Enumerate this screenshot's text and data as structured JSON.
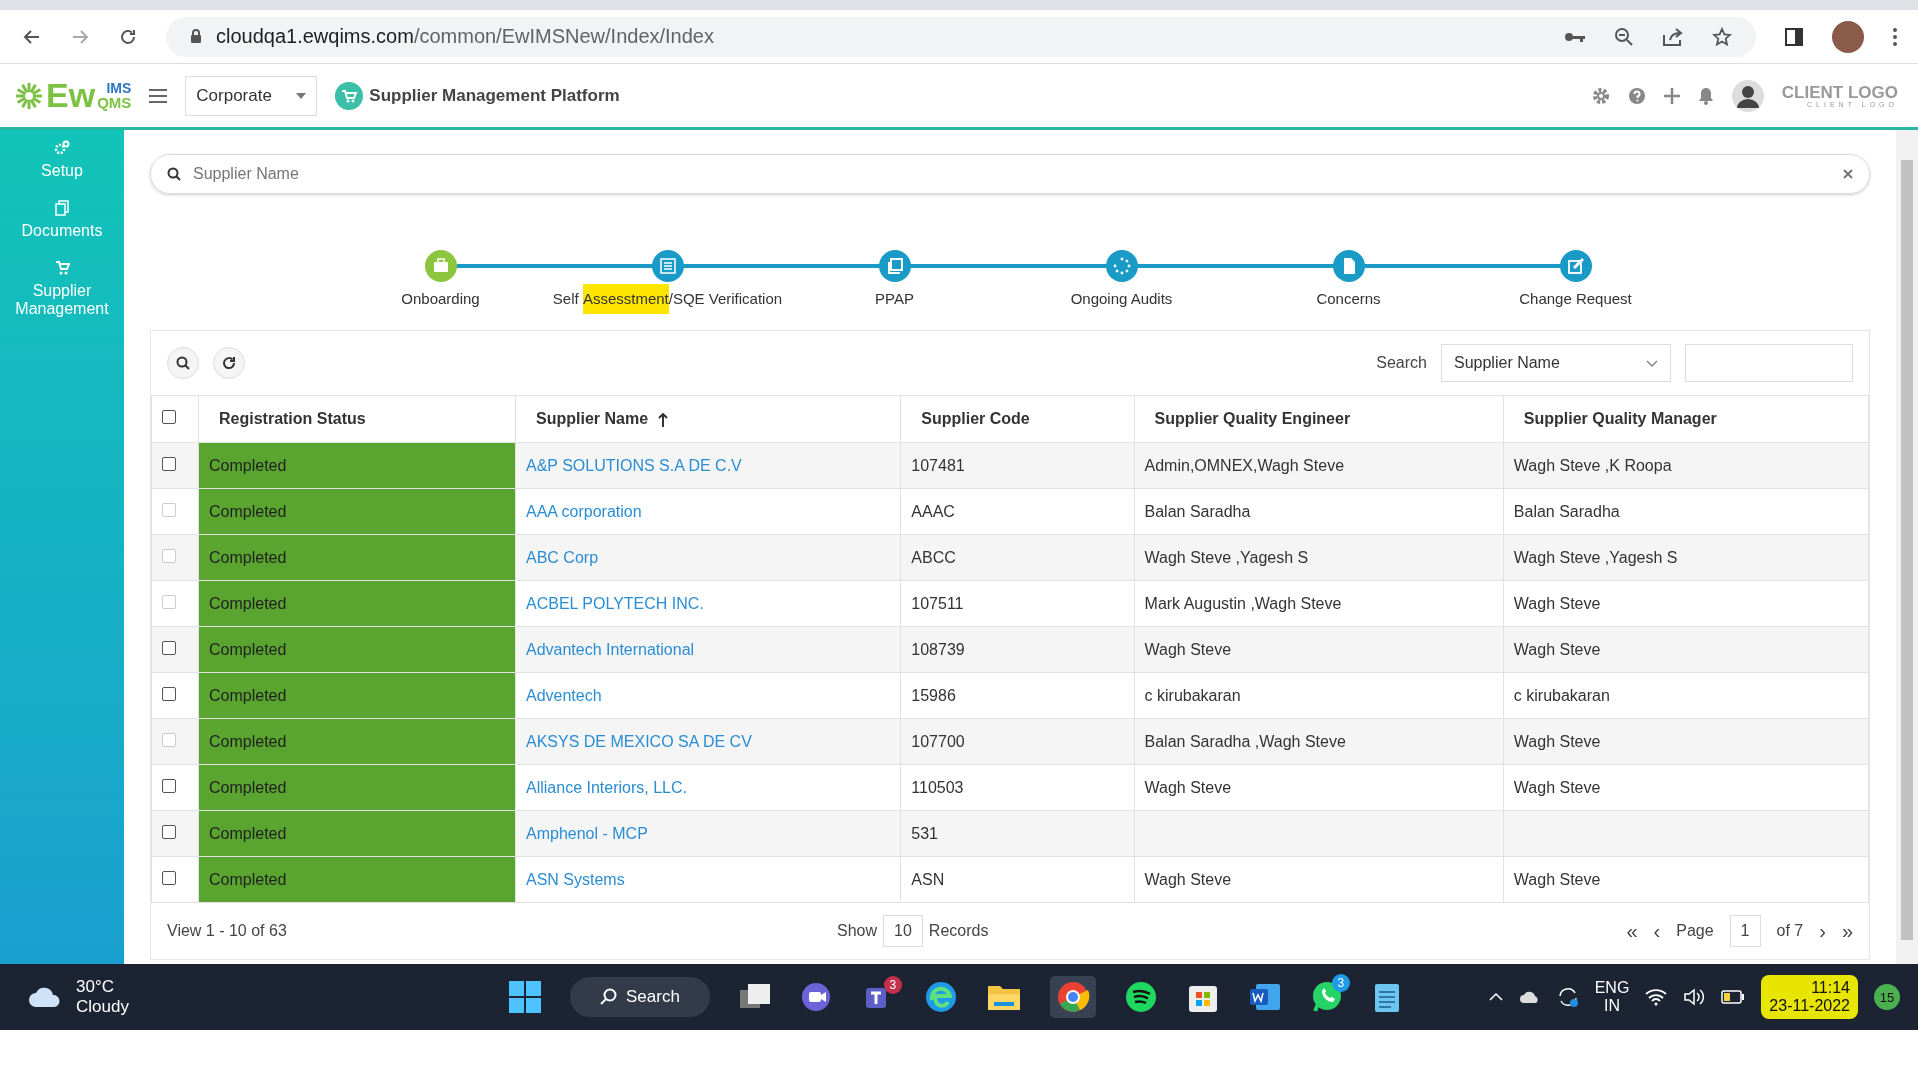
{
  "browser": {
    "url_host": "cloudqa1.ewqims.com",
    "url_path": "/common/EwIMSNew/Index/Index"
  },
  "header": {
    "logo_main": "Ew",
    "logo_top": "IMS",
    "logo_bottom": "QMS",
    "unit_select": "Corporate",
    "platform_title": "Supplier Management Platform",
    "client_logo": "CLIENT LOGO",
    "client_logo_sub": "CLIENT LOGO"
  },
  "sidebar": {
    "items": [
      {
        "label": "Setup"
      },
      {
        "label": "Documents"
      },
      {
        "label": "Supplier Management"
      }
    ]
  },
  "search": {
    "placeholder": "Supplier Name"
  },
  "steps": [
    {
      "label": [
        {
          "text": "Onboarding",
          "highlight": false
        }
      ],
      "color": "#8cc63f"
    },
    {
      "label": [
        {
          "text": "Self ",
          "highlight": false
        },
        {
          "text": "Assesstment",
          "highlight": true
        },
        {
          "text": "/SQE Verification",
          "highlight": false
        }
      ],
      "color": "#1a9bc7"
    },
    {
      "label": [
        {
          "text": "PPAP",
          "highlight": false
        }
      ],
      "color": "#1a9bc7"
    },
    {
      "label": [
        {
          "text": "Ongoing Audits",
          "highlight": false
        }
      ],
      "color": "#1a9bc7"
    },
    {
      "label": [
        {
          "text": "Concerns",
          "highlight": false
        }
      ],
      "color": "#1a9bc7"
    },
    {
      "label": [
        {
          "text": "Change Request",
          "highlight": false
        }
      ],
      "color": "#1a9bc7"
    }
  ],
  "toolbar": {
    "search_label": "Search",
    "search_by": "Supplier Name"
  },
  "table": {
    "select_all_checked": false,
    "columns": [
      {
        "label": "Registration Status",
        "sorted": false
      },
      {
        "label": "Supplier Name",
        "sorted": true
      },
      {
        "label": "Supplier Code",
        "sorted": false
      },
      {
        "label": "Supplier Quality Engineer",
        "sorted": false
      },
      {
        "label": "Supplier Quality Manager",
        "sorted": false
      }
    ],
    "rows": [
      {
        "checked": false,
        "disabled": false,
        "status": "Completed",
        "name": "A&P SOLUTIONS S.A DE C.V",
        "code": "107481",
        "engineer": "Admin,OMNEX,Wagh Steve",
        "manager": "Wagh Steve ,K Roopa"
      },
      {
        "checked": false,
        "disabled": true,
        "status": "Completed",
        "name": "AAA corporation",
        "code": "AAAC",
        "engineer": "Balan Saradha",
        "manager": "Balan Saradha"
      },
      {
        "checked": false,
        "disabled": true,
        "status": "Completed",
        "name": "ABC Corp",
        "code": "ABCC",
        "engineer": "Wagh Steve ,Yagesh S",
        "manager": "Wagh Steve ,Yagesh S"
      },
      {
        "checked": false,
        "disabled": true,
        "status": "Completed",
        "name": "ACBEL POLYTECH INC.",
        "code": "107511",
        "engineer": "Mark Augustin ,Wagh Steve",
        "manager": "Wagh Steve"
      },
      {
        "checked": false,
        "disabled": false,
        "status": "Completed",
        "name": "Advantech International",
        "code": "108739",
        "engineer": "Wagh Steve",
        "manager": "Wagh Steve"
      },
      {
        "checked": false,
        "disabled": false,
        "status": "Completed",
        "name": "Adventech",
        "code": "15986",
        "engineer": "c kirubakaran",
        "manager": "c kirubakaran"
      },
      {
        "checked": false,
        "disabled": true,
        "status": "Completed",
        "name": "AKSYS DE MEXICO SA DE CV",
        "code": "107700",
        "engineer": "Balan Saradha ,Wagh Steve",
        "manager": "Wagh Steve"
      },
      {
        "checked": false,
        "disabled": false,
        "status": "Completed",
        "name": "Alliance Interiors, LLC.",
        "code": "110503",
        "engineer": "Wagh Steve",
        "manager": "Wagh Steve"
      },
      {
        "checked": false,
        "disabled": false,
        "status": "Completed",
        "name": "Amphenol - MCP",
        "code": "531"
      },
      {
        "checked": false,
        "disabled": false,
        "status": "Completed",
        "name": "ASN Systems",
        "code": "ASN",
        "engineer": "Wagh Steve",
        "manager": "Wagh Steve"
      }
    ]
  },
  "footer": {
    "view": "View 1 - 10 of 63",
    "first": "«",
    "prev": "‹",
    "next": "›",
    "last": "»",
    "show": "Show",
    "page_size": "10",
    "records": "Records",
    "page_label": "Page",
    "page": "1",
    "of": "of 7"
  },
  "taskbar": {
    "temp": "30°C",
    "weather": "Cloudy",
    "search": "Search",
    "teams_badge": "3",
    "whatsapp_badge": "3",
    "lang": "ENG",
    "region": "IN",
    "time": "11:14",
    "date": "23-11-2022",
    "notif": "15"
  }
}
